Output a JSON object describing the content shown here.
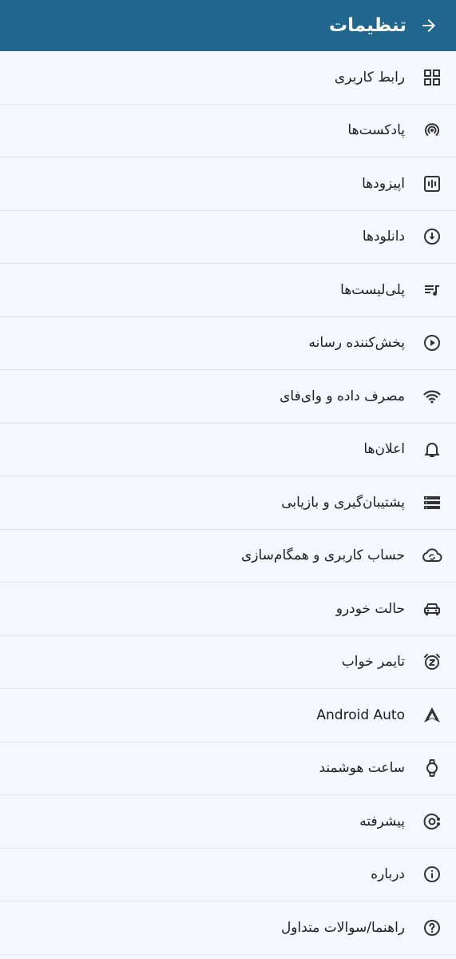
{
  "header": {
    "title": "تنظیمات",
    "back_icon": "arrow-forward-icon",
    "bg_color": "#21668c"
  },
  "items": [
    {
      "label": "رابط کاربری",
      "icon": "grid-icon"
    },
    {
      "label": "پادکست‌ها",
      "icon": "podcast-icon"
    },
    {
      "label": "اپیزودها",
      "icon": "episode-icon"
    },
    {
      "label": "دانلودها",
      "icon": "download-icon"
    },
    {
      "label": "پلی‌لیست‌ها",
      "icon": "playlist-icon"
    },
    {
      "label": "پخش‌کننده رسانه",
      "icon": "play-icon"
    },
    {
      "label": "مصرف داده و وای‌فای",
      "icon": "wifi-icon"
    },
    {
      "label": "اعلان‌ها",
      "icon": "bell-icon"
    },
    {
      "label": "پشتیبان‌گیری و بازیابی",
      "icon": "storage-icon"
    },
    {
      "label": "حساب کاربری و همگام‌سازی",
      "icon": "cloud-sync-icon"
    },
    {
      "label": "حالت خودرو",
      "icon": "car-icon"
    },
    {
      "label": "تایمر خواب",
      "icon": "alarm-icon"
    },
    {
      "label": "Android Auto",
      "icon": "android-auto-icon"
    },
    {
      "label": "ساعت هوشمند",
      "icon": "watch-icon"
    },
    {
      "label": "پیشرفته",
      "icon": "settings-advanced-icon"
    },
    {
      "label": "درباره",
      "icon": "info-icon"
    },
    {
      "label": "راهنما/سوالات متداول",
      "icon": "help-icon"
    }
  ]
}
